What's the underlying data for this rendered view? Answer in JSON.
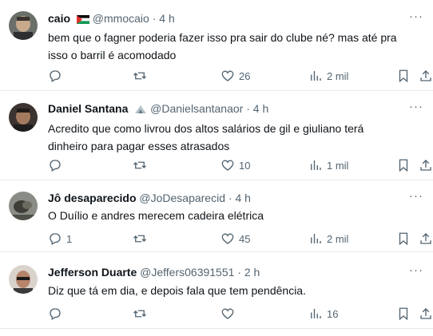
{
  "tweets": [
    {
      "name": "caio",
      "handle": "@mmocaio",
      "time": "4 h",
      "text": "bem que o fagner poderia fazer isso pra sair do clube né? mas até pra isso o barril é acomodado",
      "reply_count": "",
      "like_count": "26",
      "view_count": "2 mil",
      "name_emoji": "palestine-flag-icon"
    },
    {
      "name": "Daniel Santana",
      "handle": "@Danielsantanaor",
      "time": "4 h",
      "text": "Acredito que como livrou dos altos salários de gil e giuliano terá dinheiro para pagar esses atrasados",
      "reply_count": "",
      "like_count": "10",
      "view_count": "1 mil",
      "name_emoji": "badge-icon"
    },
    {
      "name": "Jô desaparecido",
      "handle": "@JoDesaparecid",
      "time": "4 h",
      "text": "O Duílio e andres merecem cadeira elétrica",
      "reply_count": "1",
      "like_count": "45",
      "view_count": "2 mil"
    },
    {
      "name": "Jefferson Duarte",
      "handle": "@Jeffers06391551",
      "time": "2 h",
      "text": "Diz que tá em dia, e depois fala que tem pendência.",
      "reply_count": "",
      "like_count": "",
      "view_count": "16"
    }
  ],
  "separator": "·",
  "more_label": "···",
  "colors": {
    "text": "#0f1419",
    "secondary": "#536471",
    "divider": "#e6e9ec"
  }
}
